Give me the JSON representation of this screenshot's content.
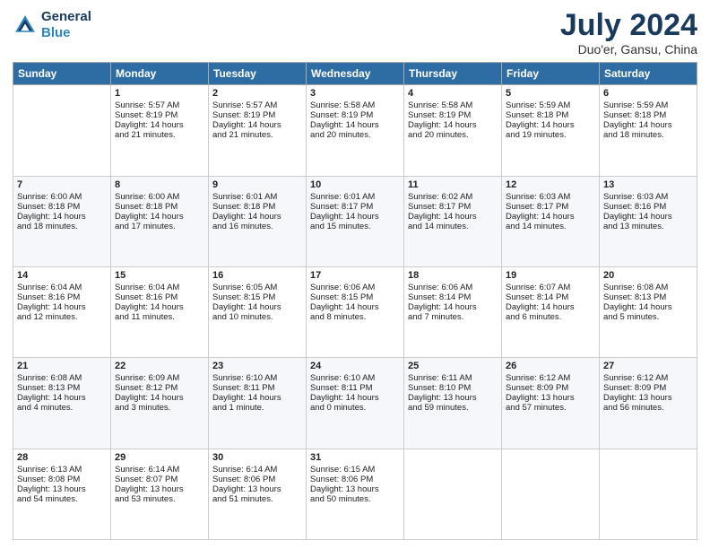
{
  "header": {
    "logo_line1": "General",
    "logo_line2": "Blue",
    "title": "July 2024",
    "subtitle": "Duo'er, Gansu, China"
  },
  "weekdays": [
    "Sunday",
    "Monday",
    "Tuesday",
    "Wednesday",
    "Thursday",
    "Friday",
    "Saturday"
  ],
  "weeks": [
    [
      {
        "day": "",
        "info": ""
      },
      {
        "day": "1",
        "info": "Sunrise: 5:57 AM\nSunset: 8:19 PM\nDaylight: 14 hours\nand 21 minutes."
      },
      {
        "day": "2",
        "info": "Sunrise: 5:57 AM\nSunset: 8:19 PM\nDaylight: 14 hours\nand 21 minutes."
      },
      {
        "day": "3",
        "info": "Sunrise: 5:58 AM\nSunset: 8:19 PM\nDaylight: 14 hours\nand 20 minutes."
      },
      {
        "day": "4",
        "info": "Sunrise: 5:58 AM\nSunset: 8:19 PM\nDaylight: 14 hours\nand 20 minutes."
      },
      {
        "day": "5",
        "info": "Sunrise: 5:59 AM\nSunset: 8:18 PM\nDaylight: 14 hours\nand 19 minutes."
      },
      {
        "day": "6",
        "info": "Sunrise: 5:59 AM\nSunset: 8:18 PM\nDaylight: 14 hours\nand 18 minutes."
      }
    ],
    [
      {
        "day": "7",
        "info": "Sunrise: 6:00 AM\nSunset: 8:18 PM\nDaylight: 14 hours\nand 18 minutes."
      },
      {
        "day": "8",
        "info": "Sunrise: 6:00 AM\nSunset: 8:18 PM\nDaylight: 14 hours\nand 17 minutes."
      },
      {
        "day": "9",
        "info": "Sunrise: 6:01 AM\nSunset: 8:18 PM\nDaylight: 14 hours\nand 16 minutes."
      },
      {
        "day": "10",
        "info": "Sunrise: 6:01 AM\nSunset: 8:17 PM\nDaylight: 14 hours\nand 15 minutes."
      },
      {
        "day": "11",
        "info": "Sunrise: 6:02 AM\nSunset: 8:17 PM\nDaylight: 14 hours\nand 14 minutes."
      },
      {
        "day": "12",
        "info": "Sunrise: 6:03 AM\nSunset: 8:17 PM\nDaylight: 14 hours\nand 14 minutes."
      },
      {
        "day": "13",
        "info": "Sunrise: 6:03 AM\nSunset: 8:16 PM\nDaylight: 14 hours\nand 13 minutes."
      }
    ],
    [
      {
        "day": "14",
        "info": "Sunrise: 6:04 AM\nSunset: 8:16 PM\nDaylight: 14 hours\nand 12 minutes."
      },
      {
        "day": "15",
        "info": "Sunrise: 6:04 AM\nSunset: 8:16 PM\nDaylight: 14 hours\nand 11 minutes."
      },
      {
        "day": "16",
        "info": "Sunrise: 6:05 AM\nSunset: 8:15 PM\nDaylight: 14 hours\nand 10 minutes."
      },
      {
        "day": "17",
        "info": "Sunrise: 6:06 AM\nSunset: 8:15 PM\nDaylight: 14 hours\nand 8 minutes."
      },
      {
        "day": "18",
        "info": "Sunrise: 6:06 AM\nSunset: 8:14 PM\nDaylight: 14 hours\nand 7 minutes."
      },
      {
        "day": "19",
        "info": "Sunrise: 6:07 AM\nSunset: 8:14 PM\nDaylight: 14 hours\nand 6 minutes."
      },
      {
        "day": "20",
        "info": "Sunrise: 6:08 AM\nSunset: 8:13 PM\nDaylight: 14 hours\nand 5 minutes."
      }
    ],
    [
      {
        "day": "21",
        "info": "Sunrise: 6:08 AM\nSunset: 8:13 PM\nDaylight: 14 hours\nand 4 minutes."
      },
      {
        "day": "22",
        "info": "Sunrise: 6:09 AM\nSunset: 8:12 PM\nDaylight: 14 hours\nand 3 minutes."
      },
      {
        "day": "23",
        "info": "Sunrise: 6:10 AM\nSunset: 8:11 PM\nDaylight: 14 hours\nand 1 minute."
      },
      {
        "day": "24",
        "info": "Sunrise: 6:10 AM\nSunset: 8:11 PM\nDaylight: 14 hours\nand 0 minutes."
      },
      {
        "day": "25",
        "info": "Sunrise: 6:11 AM\nSunset: 8:10 PM\nDaylight: 13 hours\nand 59 minutes."
      },
      {
        "day": "26",
        "info": "Sunrise: 6:12 AM\nSunset: 8:09 PM\nDaylight: 13 hours\nand 57 minutes."
      },
      {
        "day": "27",
        "info": "Sunrise: 6:12 AM\nSunset: 8:09 PM\nDaylight: 13 hours\nand 56 minutes."
      }
    ],
    [
      {
        "day": "28",
        "info": "Sunrise: 6:13 AM\nSunset: 8:08 PM\nDaylight: 13 hours\nand 54 minutes."
      },
      {
        "day": "29",
        "info": "Sunrise: 6:14 AM\nSunset: 8:07 PM\nDaylight: 13 hours\nand 53 minutes."
      },
      {
        "day": "30",
        "info": "Sunrise: 6:14 AM\nSunset: 8:06 PM\nDaylight: 13 hours\nand 51 minutes."
      },
      {
        "day": "31",
        "info": "Sunrise: 6:15 AM\nSunset: 8:06 PM\nDaylight: 13 hours\nand 50 minutes."
      },
      {
        "day": "",
        "info": ""
      },
      {
        "day": "",
        "info": ""
      },
      {
        "day": "",
        "info": ""
      }
    ]
  ]
}
